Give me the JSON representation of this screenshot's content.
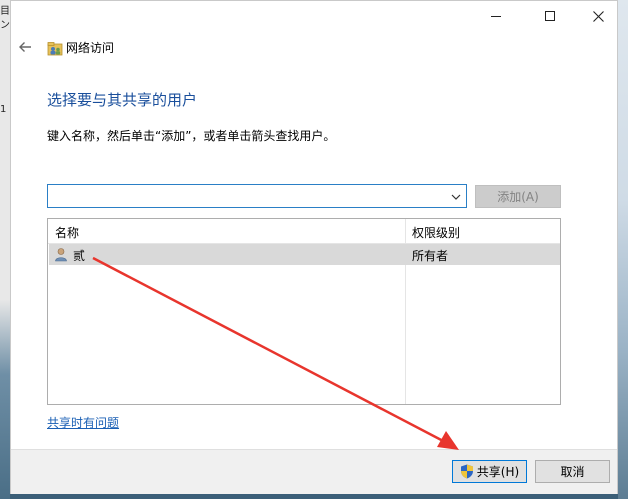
{
  "desktop": {
    "left_chars": [
      "目",
      "ン",
      "1"
    ]
  },
  "window": {
    "controls": {
      "minimize": "minimize",
      "maximize": "maximize",
      "close": "close"
    }
  },
  "header": {
    "title": "网络访问"
  },
  "main": {
    "heading": "选择要与其共享的用户",
    "instruction": "键入名称，然后单击“添加”，或者单击箭头查找用户。",
    "search": {
      "value": "",
      "placeholder": ""
    },
    "add_button": "添加(A)"
  },
  "table": {
    "columns": [
      "名称",
      "权限级别"
    ],
    "rows": [
      {
        "name": "贰",
        "permission": "所有者"
      }
    ]
  },
  "help_link": "共享时有问题",
  "footer": {
    "share_button": "共享(H)",
    "cancel_button": "取消"
  },
  "colors": {
    "accent": "#1a4f9c",
    "link": "#1a5fb4",
    "annotation_arrow": "#e8352d",
    "selected_row": "#d9d9d9"
  }
}
